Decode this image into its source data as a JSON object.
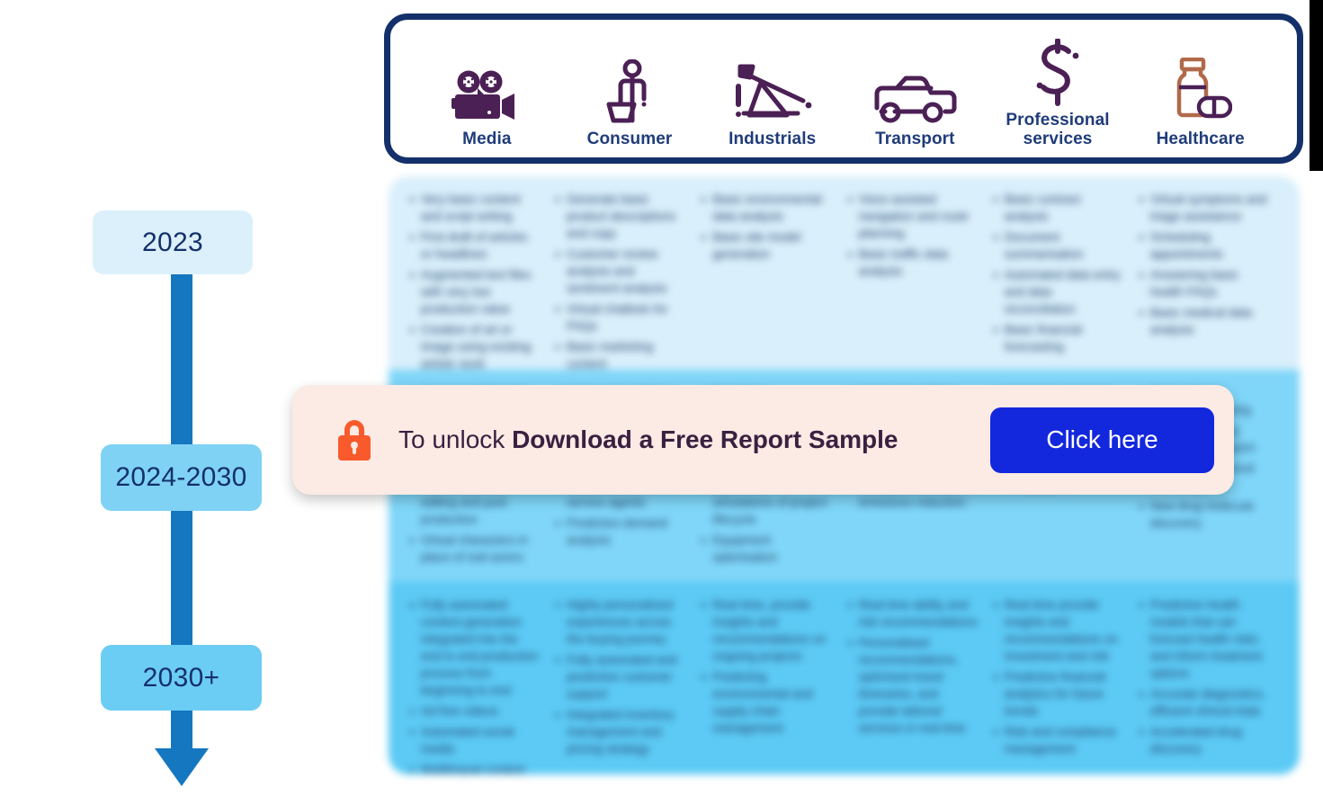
{
  "sectors": [
    {
      "label": "Media",
      "icon": "movie-camera-icon"
    },
    {
      "label": "Consumer",
      "icon": "shopper-person-icon"
    },
    {
      "label": "Industrials",
      "icon": "oil-pumpjack-icon"
    },
    {
      "label": "Transport",
      "icon": "car-icon"
    },
    {
      "label": "Professional\nservices",
      "icon": "dollar-sign-icon"
    },
    {
      "label": "Healthcare",
      "icon": "medicine-bottle-pills-icon"
    }
  ],
  "timeline": {
    "steps": [
      {
        "label": "2023"
      },
      {
        "label": "2024-2030"
      },
      {
        "label": "2030+"
      }
    ]
  },
  "banner": {
    "lead_text": "To unlock ",
    "strong_text": "Download a Free Report Sample",
    "button_label": "Click here",
    "lock_icon": "lock-icon",
    "accent_color": "#1327dd",
    "lock_color": "#f95a2c",
    "background_color": "#fceae4"
  },
  "colors": {
    "sector_border": "#14306b",
    "sector_label": "#1f3c7a",
    "icon": "#3d2252",
    "band_2023": "#d9effb",
    "band_2024": "#7fd6f8",
    "band_2030": "#5ccaf5",
    "timeline_shaft": "#1577c0",
    "timeline_text": "#14306b"
  },
  "content": {
    "rows": [
      {
        "period": "2023",
        "columns": [
          {
            "sector": "Media",
            "items": [
              "Very basic content and script writing",
              "First draft of articles or headlines",
              "Augmented text files with very low production value",
              "Creation of art or image using existing artistic work"
            ]
          },
          {
            "sector": "Consumer",
            "items": [
              "Generate basic product descriptions and copy",
              "Customer review analysis and sentiment analysis",
              "Virtual chatbots for FAQs",
              "Basic marketing content"
            ]
          },
          {
            "sector": "Industrials",
            "items": [
              "Basic environmental data analysis",
              "Basic site model generation"
            ]
          },
          {
            "sector": "Transport",
            "items": [
              "Voice assisted navigation and route planning",
              "Basic traffic data analysis"
            ]
          },
          {
            "sector": "Professional services",
            "items": [
              "Basic contract analysis",
              "Document summarisation",
              "Automated data entry and data reconciliation",
              "Basic financial forecasting"
            ]
          },
          {
            "sector": "Healthcare",
            "items": [
              "Virtual symptoms and triage assistance",
              "Scheduling appointments",
              "Answering basic health FAQs",
              "Basic medical data analysis"
            ]
          }
        ]
      },
      {
        "period": "2024-2030",
        "columns": [
          {
            "sector": "Media",
            "items": [
              "Generate full length scripts and screenplays",
              "Personalised content recommendations",
              "Automated video editing and post production",
              "Virtual characters in place of real actors"
            ]
          },
          {
            "sector": "Consumer",
            "items": [
              "Hyper personalised product recommendations",
              "Dynamic pricing optimisation",
              "Automated customer service agents",
              "Predictive demand analysis"
            ]
          },
          {
            "sector": "Industrials",
            "items": [
              "Predictive maintenance scheduling",
              "Automated design generation",
              "Digital twin simulations of project lifecycle",
              "Equipment optimisation"
            ]
          },
          {
            "sector": "Transport",
            "items": [
              "Autonomous fleet routing",
              "Predictive maintenance of vehicles",
              "Energy efficiency and emissions reduction"
            ]
          },
          {
            "sector": "Professional services",
            "items": [
              "Automated contract drafting and review",
              "Advanced risk and compliance analysis",
              "Case studies and whitepapers"
            ]
          },
          {
            "sector": "Healthcare",
            "items": [
              "Personalised treatment planning",
              "Medical imaging diagnostics support",
              "Accelerated clinical trial design",
              "New drug molecule discovery"
            ]
          }
        ]
      },
      {
        "period": "2030+",
        "columns": [
          {
            "sector": "Media",
            "items": [
              "Fully automated content generation integrated into the end to end production process from beginning to end",
              "Ad free videos",
              "Automated social media",
              "Multilingual content distribution flow"
            ]
          },
          {
            "sector": "Consumer",
            "items": [
              "Highly personalised experiences across the buying journey",
              "Fully automated and predictive customer support",
              "Integrated inventory management and pricing strategy"
            ]
          },
          {
            "sector": "Industrials",
            "items": [
              "Real time, provide insights and recommendations on ongoing projects",
              "Predicting environmental and supply chain management"
            ]
          },
          {
            "sector": "Transport",
            "items": [
              "Real time ability and risk recommendations",
              "Personalised recommendations, optimised travel itineraries, and provide tailored services in real time"
            ]
          },
          {
            "sector": "Professional services",
            "items": [
              "Real time provide insights and recommendations on investment and risk",
              "Predictive financial analytics for future trends",
              "Risk and compliance management"
            ]
          },
          {
            "sector": "Healthcare",
            "items": [
              "Predictive health models that can forecast health risks and inform treatment options",
              "Accurate diagnostics, efficient clinical trials",
              "Accelerated drug discovery"
            ]
          }
        ]
      }
    ]
  }
}
